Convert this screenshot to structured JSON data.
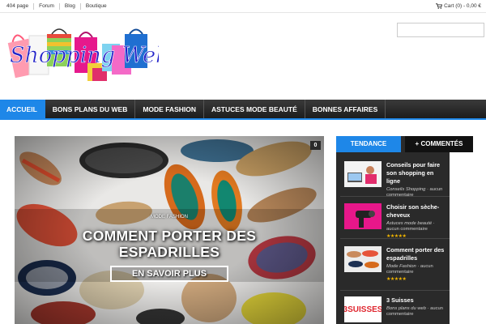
{
  "topnav": [
    "404 page",
    "Forum",
    "Blog",
    "Boutique"
  ],
  "cart": {
    "label": "Cart (0) - 0,00 €"
  },
  "logo": {
    "text": "Shopping Web"
  },
  "search": {
    "placeholder": ""
  },
  "nav": [
    "ACCUEIL",
    "BONS PLANS DU WEB",
    "MODE FASHION",
    "ASTUCES MODE BEAUTÉ",
    "BONNES AFFAIRES"
  ],
  "hero": {
    "count": "0",
    "category": "MODE FASHION",
    "title_line1": "COMMENT PORTER DES",
    "title_line2": "ESPADRILLES",
    "button": "EN SAVOIR PLUS"
  },
  "tabs": [
    "TENDANCE",
    "+ COMMENTÉS"
  ],
  "posts": [
    {
      "title": "Conseils pour faire son shopping en ligne",
      "cat": "Conseils Shopping",
      "meta": "aucun commentaire"
    },
    {
      "title": "Choisir son sèche-cheveux",
      "cat": "Astuces mode beauté",
      "meta": "aucun commentaire"
    },
    {
      "title": "Comment porter des espadrilles",
      "cat": "Mode Fashion",
      "meta": "aucun commentaire"
    },
    {
      "title": "3 Suisses",
      "cat": "Bons plans du web",
      "meta": "aucun commentaire",
      "thumb_text": "3SUISSES"
    }
  ],
  "colors": {
    "accent": "#1e87e8",
    "nav_bg": "#2b2b2b",
    "widget_bg": "#2a2a2a",
    "stars": "#f0b400"
  }
}
